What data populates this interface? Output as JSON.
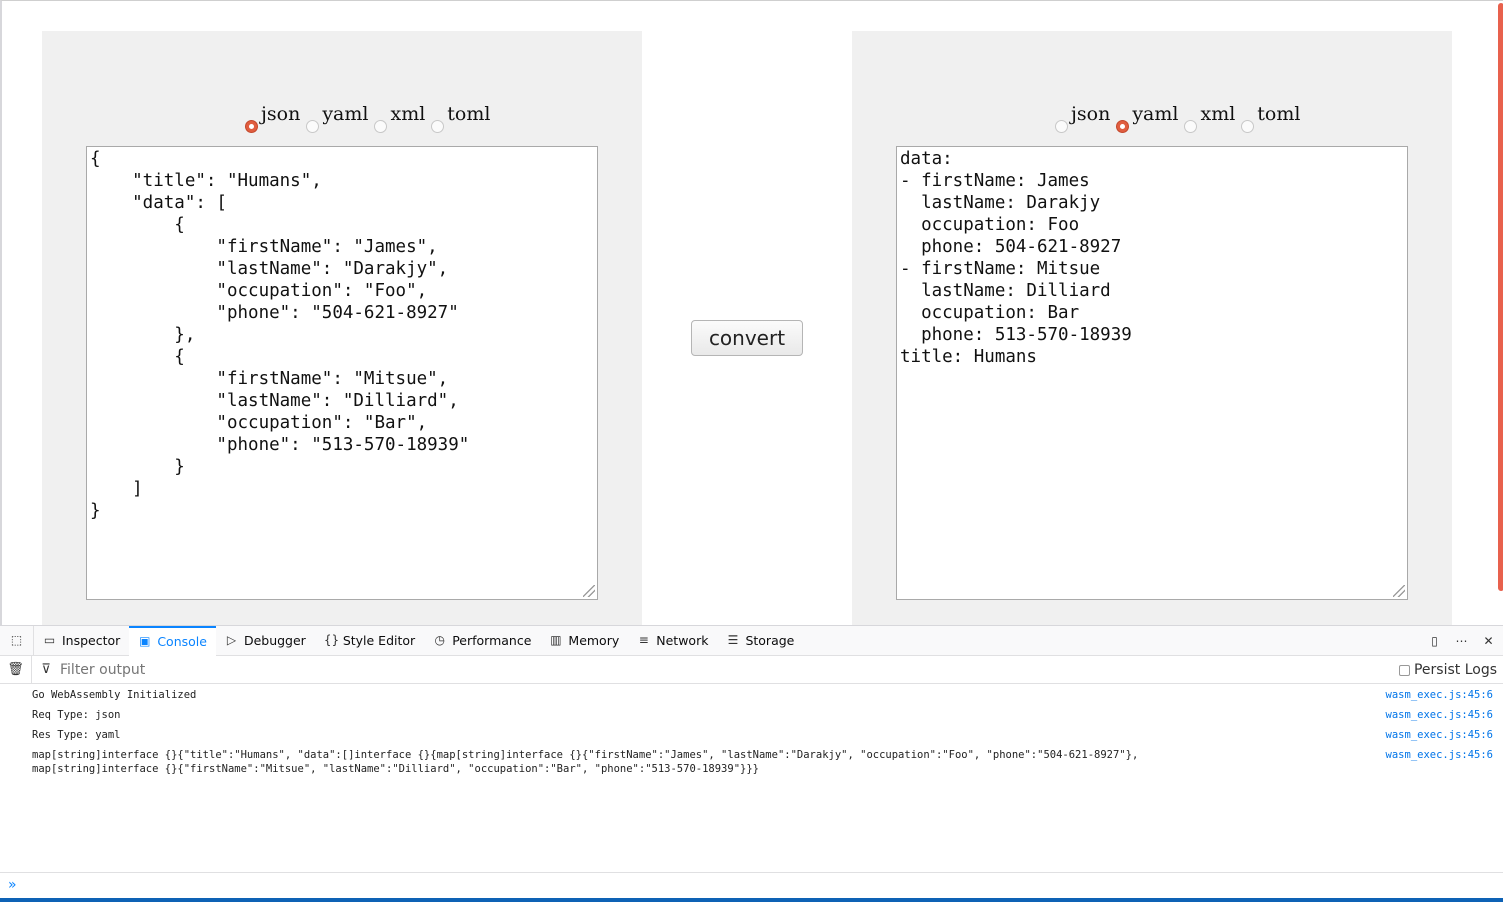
{
  "left": {
    "formats": [
      {
        "label": "json",
        "checked": true
      },
      {
        "label": "yaml",
        "checked": false
      },
      {
        "label": "xml",
        "checked": false
      },
      {
        "label": "toml",
        "checked": false
      }
    ],
    "content": "{\n    \"title\": \"Humans\",\n    \"data\": [\n        {\n            \"firstName\": \"James\",\n            \"lastName\": \"Darakjy\",\n            \"occupation\": \"Foo\",\n            \"phone\": \"504-621-8927\"\n        },\n        {\n            \"firstName\": \"Mitsue\",\n            \"lastName\": \"Dilliard\",\n            \"occupation\": \"Bar\",\n            \"phone\": \"513-570-18939\"\n        }\n    ]\n}"
  },
  "right": {
    "formats": [
      {
        "label": "json",
        "checked": false
      },
      {
        "label": "yaml",
        "checked": true
      },
      {
        "label": "xml",
        "checked": false
      },
      {
        "label": "toml",
        "checked": false
      }
    ],
    "content": "data:\n- firstName: James\n  lastName: Darakjy\n  occupation: Foo\n  phone: 504-621-8927\n- firstName: Mitsue\n  lastName: Dilliard\n  occupation: Bar\n  phone: 513-570-18939\ntitle: Humans"
  },
  "convert_label": "convert",
  "devtools": {
    "tabs": [
      {
        "label": "Inspector",
        "icon": "inspector-icon",
        "glyph": "▭",
        "active": false
      },
      {
        "label": "Console",
        "icon": "console-icon",
        "glyph": "▣",
        "active": true
      },
      {
        "label": "Debugger",
        "icon": "debugger-icon",
        "glyph": "▷",
        "active": false
      },
      {
        "label": "Style Editor",
        "icon": "style-editor-icon",
        "glyph": "{}",
        "active": false
      },
      {
        "label": "Performance",
        "icon": "performance-icon",
        "glyph": "◷",
        "active": false
      },
      {
        "label": "Memory",
        "icon": "memory-icon",
        "glyph": "▥",
        "active": false
      },
      {
        "label": "Network",
        "icon": "network-icon",
        "glyph": "≡",
        "active": false
      },
      {
        "label": "Storage",
        "icon": "storage-icon",
        "glyph": "☰",
        "active": false
      }
    ],
    "filter_placeholder": "Filter output",
    "persist_label": "Persist Logs",
    "logs": [
      {
        "text": "Go WebAssembly Initialized",
        "source": "wasm_exec.js:45:6"
      },
      {
        "text": "Req Type: json",
        "source": "wasm_exec.js:45:6"
      },
      {
        "text": "Res Type: yaml",
        "source": "wasm_exec.js:45:6"
      },
      {
        "text": "map[string]interface {}{\"title\":\"Humans\", \"data\":[]interface {}{map[string]interface {}{\"firstName\":\"James\", \"lastName\":\"Darakjy\", \"occupation\":\"Foo\", \"phone\":\"504-621-8927\"},\nmap[string]interface {}{\"firstName\":\"Mitsue\", \"lastName\":\"Dilliard\", \"occupation\":\"Bar\", \"phone\":\"513-570-18939\"}}}",
        "source": "wasm_exec.js:45:6"
      }
    ],
    "prompt_glyph": "»"
  },
  "colors": {
    "accent": "#e05d3f",
    "devtools_active": "#0a84ff",
    "link": "#0074e8"
  }
}
